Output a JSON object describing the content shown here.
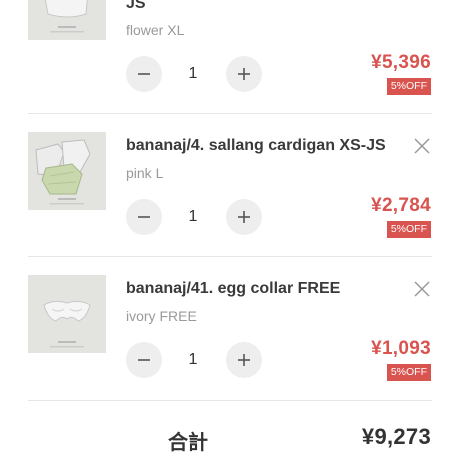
{
  "cart": {
    "items": [
      {
        "name": "JS",
        "variant": "flower XL",
        "quantity": "1",
        "price": "¥5,396",
        "discount": "5%OFF"
      },
      {
        "name": "bananaj/4. sallang cardigan XS-JS",
        "variant": "pink L",
        "quantity": "1",
        "price": "¥2,784",
        "discount": "5%OFF"
      },
      {
        "name": "bananaj/41. egg collar FREE",
        "variant": "ivory FREE",
        "quantity": "1",
        "price": "¥1,093",
        "discount": "5%OFF"
      }
    ],
    "total_label": "合計",
    "total_value": "¥9,273"
  },
  "icons": {
    "remove": "close-icon",
    "decrement": "minus-icon",
    "increment": "plus-icon"
  },
  "colors": {
    "price": "#d9534f",
    "discount_badge": "#d9534f",
    "stepper_bg": "#eeeeee",
    "thumbnail_bg": "#e3e3e0"
  }
}
